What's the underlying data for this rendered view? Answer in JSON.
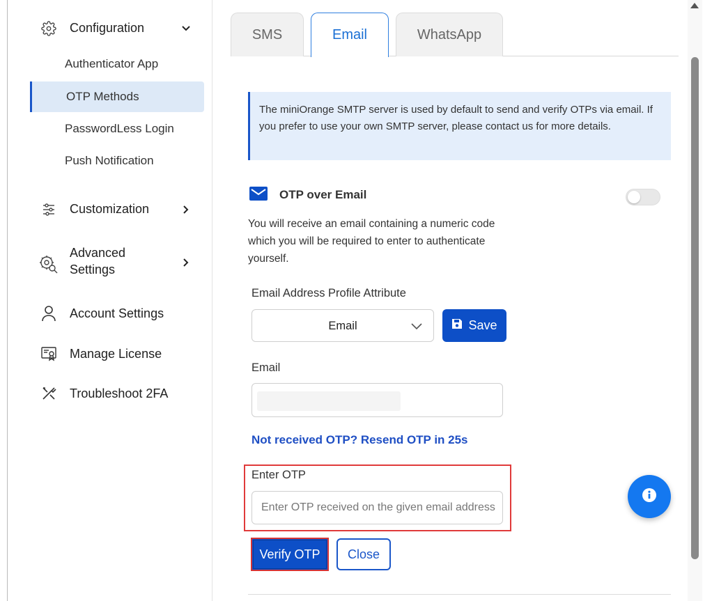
{
  "sidebar": {
    "configuration": {
      "label": "Configuration",
      "icon": "gear-icon"
    },
    "sub_items": [
      {
        "label": "Authenticator App"
      },
      {
        "label": "OTP Methods",
        "active": true
      },
      {
        "label": "PasswordLess Login"
      },
      {
        "label": "Push Notification"
      }
    ],
    "customization": {
      "label": "Customization",
      "icon": "sliders-icon"
    },
    "advanced": {
      "label_line1": "Advanced",
      "label_line2": "Settings",
      "icon": "gear-search-icon"
    },
    "account": {
      "label": "Account Settings",
      "icon": "user-icon"
    },
    "license": {
      "label": "Manage License",
      "icon": "certificate-icon"
    },
    "troubleshoot": {
      "label": "Troubleshoot 2FA",
      "icon": "tools-icon"
    }
  },
  "tabs": [
    {
      "label": "SMS"
    },
    {
      "label": "Email",
      "active": true
    },
    {
      "label": "WhatsApp"
    }
  ],
  "info": {
    "text": "The miniOrange SMTP server is used by default to send and verify OTPs via email. If you prefer to use your own SMTP server, please contact us for more details."
  },
  "otp_email": {
    "title": "OTP over Email",
    "toggle_on": false,
    "description": "You will receive an email containing a numeric code which you will be required to enter to authenticate yourself."
  },
  "profile_attr": {
    "label": "Email Address Profile Attribute",
    "selected": "Email",
    "save_label": "Save"
  },
  "email_field": {
    "label": "Email",
    "value": ""
  },
  "resend": {
    "text": "Not received OTP? Resend OTP in 25s"
  },
  "otp_field": {
    "label": "Enter OTP",
    "placeholder": "Enter OTP received on the given email address"
  },
  "actions": {
    "verify_label": "Verify OTP",
    "close_label": "Close"
  },
  "colors": {
    "primary": "#0d4fc7",
    "accent_tab": "#1a6fd4",
    "info_bg": "#e4eefb",
    "highlight_border": "#e03a3a",
    "fab": "#1478f0"
  }
}
